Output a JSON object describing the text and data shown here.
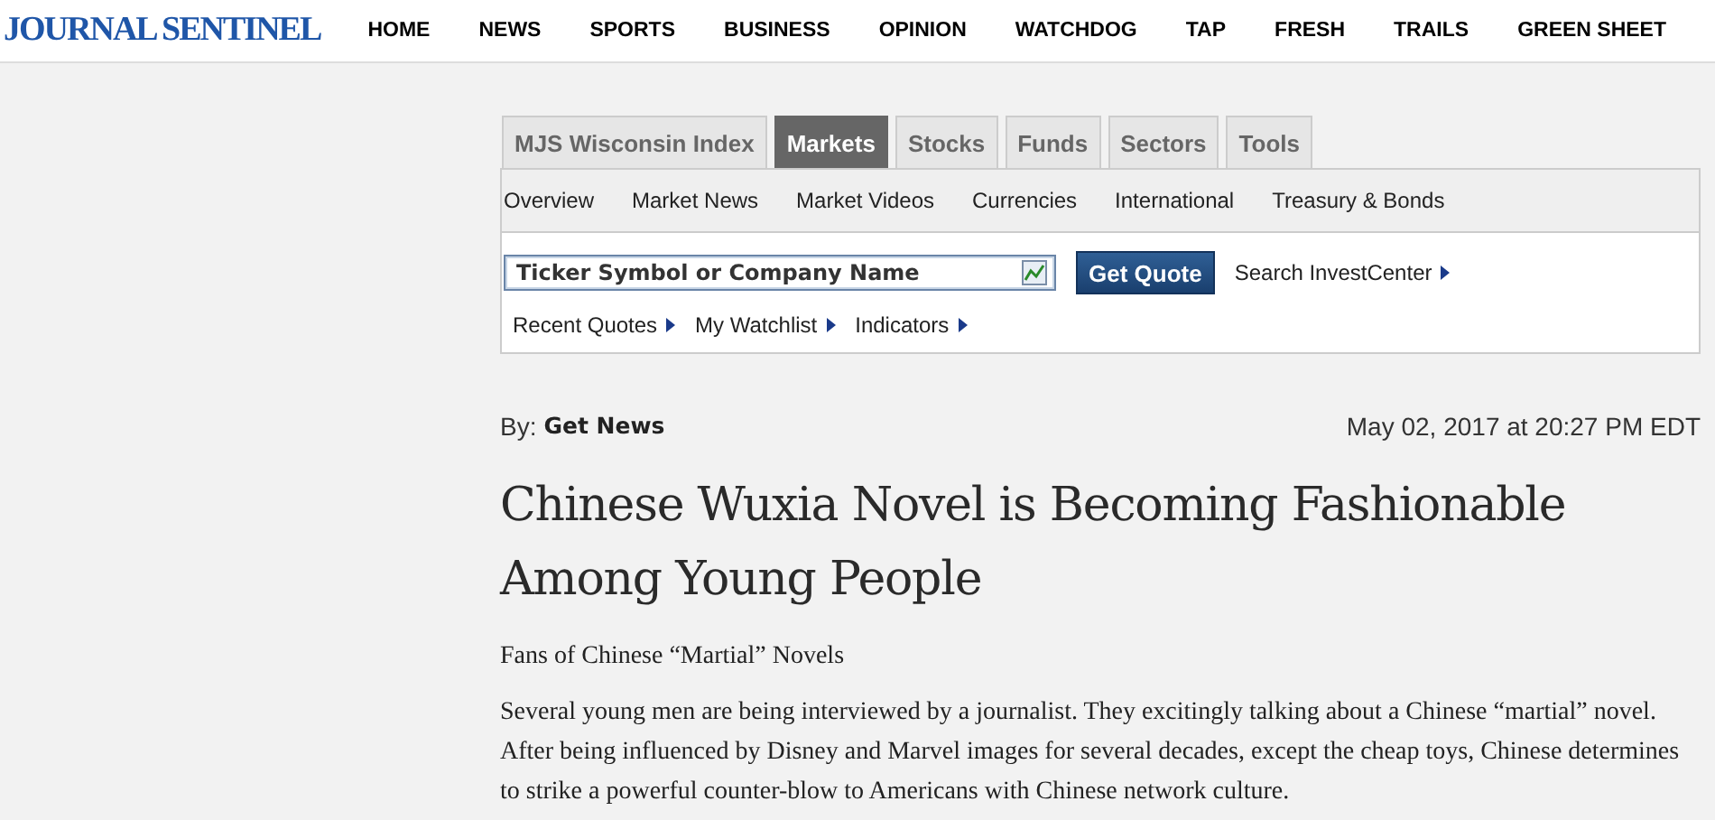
{
  "header": {
    "logo": "JOURNAL SENTINEL",
    "nav": [
      "HOME",
      "NEWS",
      "SPORTS",
      "BUSINESS",
      "OPINION",
      "WATCHDOG",
      "TAP",
      "FRESH",
      "TRAILS",
      "GREEN SHEET"
    ]
  },
  "tabs": [
    {
      "label": "MJS Wisconsin Index",
      "selected": false
    },
    {
      "label": "Markets",
      "selected": true
    },
    {
      "label": "Stocks",
      "selected": false
    },
    {
      "label": "Funds",
      "selected": false
    },
    {
      "label": "Sectors",
      "selected": false
    },
    {
      "label": "Tools",
      "selected": false
    }
  ],
  "subnav": [
    "Overview",
    "Market News",
    "Market Videos",
    "Currencies",
    "International",
    "Treasury & Bonds"
  ],
  "quote": {
    "search": {
      "placeholder": "Ticker Symbol or Company Name"
    },
    "button": "Get Quote",
    "search_link": "Search InvestCenter",
    "links": [
      "Recent Quotes",
      "My Watchlist",
      "Indicators"
    ]
  },
  "article": {
    "by_label": "By:",
    "author": "Get News",
    "date": "May 02, 2017 at 20:27 PM EDT",
    "title": "Chinese Wuxia Novel is Becoming Fashionable Among Young People",
    "subtitle": "Fans of Chinese “Martial” Novels",
    "body": "Several young men are being interviewed by a journalist. They excitingly talking about a Chinese “martial” novel. After being influenced by Disney and Marvel images for several decades, except the cheap toys, Chinese determines to strike a powerful counter-blow to Americans with Chinese network culture."
  }
}
